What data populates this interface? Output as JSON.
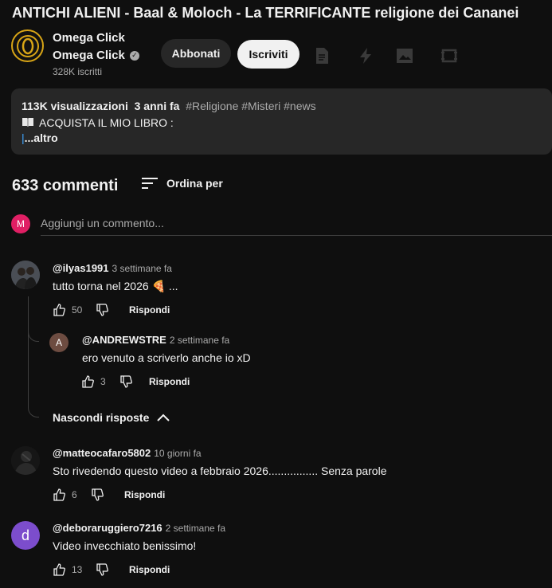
{
  "video": {
    "title": "ANTICHI ALIENI - Baal & Moloch - La TERRIFICANTE religione dei Cananei"
  },
  "channel": {
    "name_line1": "Omega Click",
    "name_line2": "Omega Click",
    "subscribers": "328K iscritti",
    "join_label": "Abbonati",
    "subscribe_label": "Iscriviti"
  },
  "top_icons": [
    "document-icon",
    "bolt-icon",
    "image-icon",
    "clip-icon"
  ],
  "description": {
    "views": "113K visualizzazioni",
    "age": "3 anni fa",
    "tags": "#Religione #Misteri #news",
    "line1": "ACQUISTA IL MIO LIBRO :",
    "more": "...altro"
  },
  "comments_header": {
    "count": "633 commenti",
    "sort_label": "Ordina per"
  },
  "add_comment": {
    "avatar_letter": "M",
    "placeholder": "Aggiungi un commento..."
  },
  "comments": [
    {
      "user": "@ilyas1991",
      "time": "3 settimane fa",
      "text": "tutto torna nel 2026 🍕 ...",
      "likes": "50",
      "reply_label": "Rispondi"
    },
    {
      "user": "@ANDREWSTRE",
      "avatar_letter": "A",
      "time": "2 settimane fa",
      "text": "ero venuto a scriverlo anche io xD",
      "likes": "3",
      "reply_label": "Rispondi"
    },
    {
      "user": "@matteocafaro5802",
      "time": "10 giorni fa",
      "text": "Sto rivedendo questo video a febbraio 2026................ Senza parole",
      "likes": "6",
      "reply_label": "Rispondi"
    },
    {
      "user": "@deboraruggiero7216",
      "avatar_letter": "d",
      "time": "2 settimane fa",
      "text": "Video invecchiato benissimo!",
      "likes": "13",
      "reply_label": "Rispondi"
    }
  ],
  "hide_replies_label": "Nascondi risposte",
  "colors": {
    "background": "#0f0f0f",
    "accent_link": "#3ea6ff",
    "avatar_pink": "#e01f64",
    "avatar_purple": "#7c4dcc",
    "avatar_brown": "#6d4c41",
    "channel_gold": "#d8a516"
  }
}
